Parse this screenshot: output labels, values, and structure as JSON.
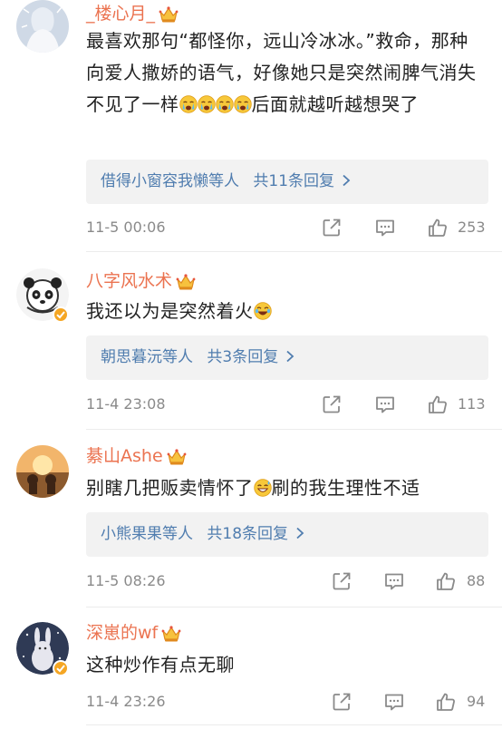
{
  "colors": {
    "username": "#eb7350",
    "reply_link": "#507daf",
    "meta": "#8a8a8a",
    "reply_bg": "#f2f2f2",
    "verified": "#f5a623"
  },
  "comments": [
    {
      "username": "_楼心月_",
      "text_parts": [
        "最喜欢那句“都怪你，远山冷冰冰。”救命，那种向爱人撒娇的语气，好像她只是突然闹脾气消失不见了一样",
        "后面就越听越想哭了"
      ],
      "emoji": "crying-face-emoji x4",
      "reply_names": "借得小窗容我懒",
      "reply_mid": "等人",
      "reply_count": "共11条回复",
      "time": "11-5 00:06",
      "likes": "253",
      "verified": false
    },
    {
      "username": "八字风水术",
      "text": "我还以为是突然着火",
      "emoji": "laughing-emoji",
      "reply_names": "朝思暮沅",
      "reply_mid": "等人",
      "reply_count": "共3条回复",
      "time": "11-4 23:08",
      "likes": "113",
      "verified": true
    },
    {
      "username": "綦山Ashe",
      "text_parts": [
        "别瞎几把贩卖情怀了",
        "刷的我生理性不适"
      ],
      "emoji": "sweat-smile-emoji",
      "reply_names": "小熊果果",
      "reply_mid": "等人",
      "reply_count": "共18条回复",
      "time": "11-5 08:26",
      "likes": "88",
      "verified": false
    },
    {
      "username": "深崽的wf",
      "text": "这种炒作有点无聊",
      "time": "11-4 23:26",
      "likes": "94",
      "verified": true
    }
  ],
  "icons": {
    "share": "share-icon",
    "comment": "comment-icon",
    "like": "thumbs-up-icon",
    "crown": "crown-badge-icon",
    "chevron": "chevron-right-icon"
  }
}
